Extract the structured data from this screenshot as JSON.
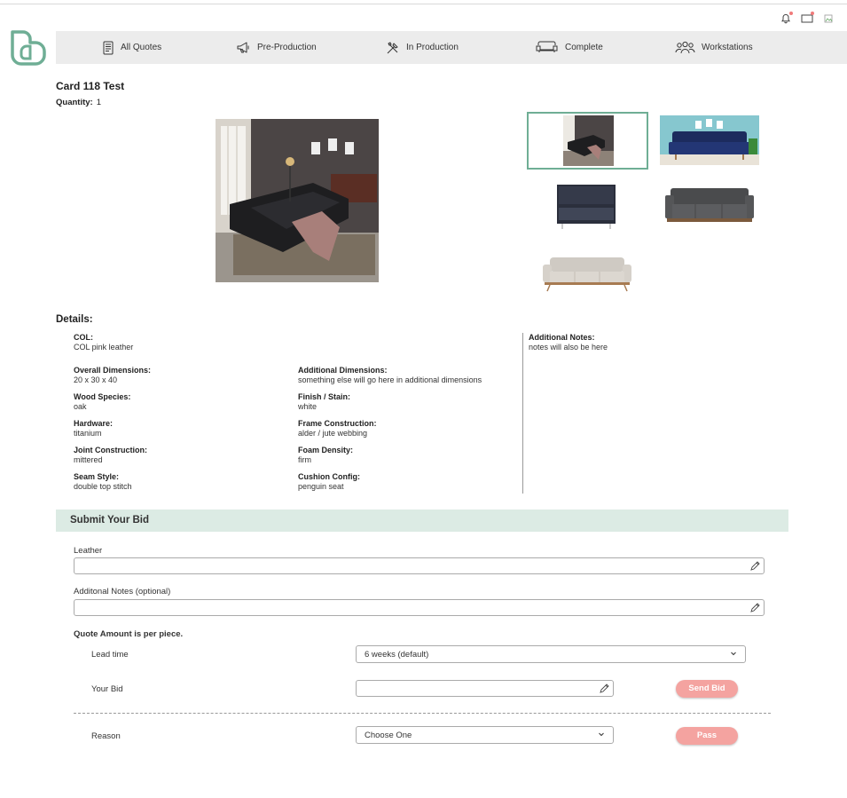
{
  "nav": {
    "items": [
      {
        "label": "All Quotes",
        "icon": "quotes-icon"
      },
      {
        "label": "Pre-Production",
        "icon": "megaphone-icon"
      },
      {
        "label": "In Production",
        "icon": "tools-icon"
      },
      {
        "label": "Complete",
        "icon": "sofa-icon"
      },
      {
        "label": "Workstations",
        "icon": "people-icon"
      }
    ]
  },
  "card": {
    "title": "Card 118 Test",
    "quantity_label": "Quantity:",
    "quantity_value": "1"
  },
  "details": {
    "heading": "Details:",
    "col": {
      "label": "COL:",
      "value": "COL pink leather"
    },
    "overall_dimensions": {
      "label": "Overall Dimensions:",
      "value": "20 x 30 x 40"
    },
    "additional_dimensions": {
      "label": "Additional Dimensions:",
      "value": "something else will go here in additional dimensions"
    },
    "wood_species": {
      "label": "Wood Species:",
      "value": "oak"
    },
    "finish_stain": {
      "label": "Finish / Stain:",
      "value": "white"
    },
    "hardware": {
      "label": "Hardware:",
      "value": "titanium"
    },
    "frame_construction": {
      "label": "Frame Construction:",
      "value": "alder / jute webbing"
    },
    "joint_construction": {
      "label": "Joint Construction:",
      "value": "mittered"
    },
    "foam_density": {
      "label": "Foam Density:",
      "value": "firm"
    },
    "seam_style": {
      "label": "Seam Style:",
      "value": "double top stitch"
    },
    "cushion_config": {
      "label": "Cushion Config:",
      "value": "penguin seat"
    },
    "additional_notes": {
      "label": "Additional Notes:",
      "value": "notes will also be here"
    }
  },
  "bid": {
    "heading": "Submit Your Bid",
    "leather_label": "Leather",
    "leather_value": "",
    "notes_label": "Additonal Notes (optional)",
    "notes_value": "",
    "per_piece_note": "Quote Amount is per piece.",
    "lead_time_label": "Lead time",
    "lead_time_value": "6 weeks (default)",
    "your_bid_label": "Your Bid",
    "your_bid_value": "",
    "send_bid_button": "Send Bid",
    "reason_label": "Reason",
    "reason_value": "Choose One",
    "pass_button": "Pass"
  },
  "colors": {
    "accent": "#6fae95",
    "nav_bg": "#ececec",
    "section_bg": "#dcebe4",
    "button_bg": "#f4a3a0"
  }
}
